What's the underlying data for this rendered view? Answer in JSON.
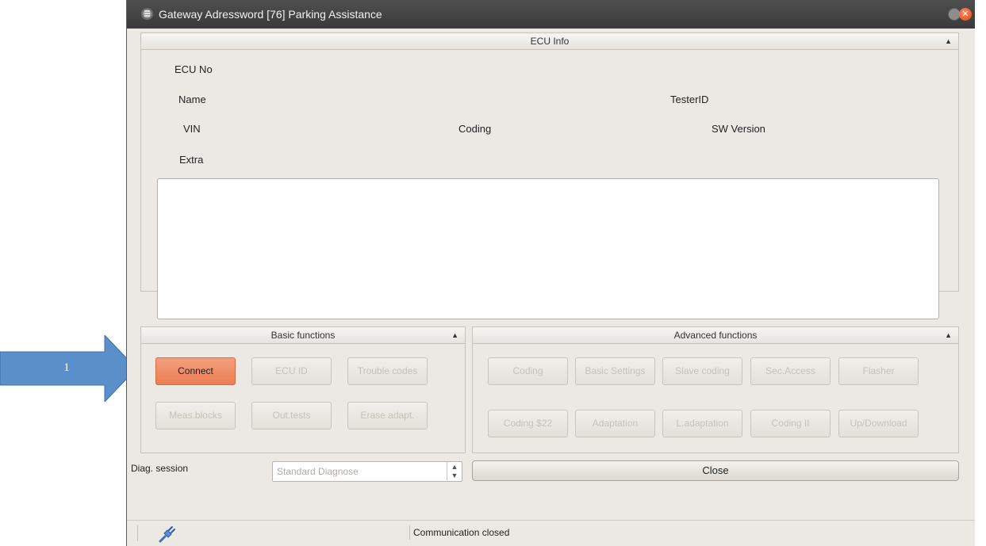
{
  "annotation": {
    "arrow_label": "1",
    "arrow_color": "#5b8fc9"
  },
  "window": {
    "title": "Gateway Adressword [76] Parking Assistance"
  },
  "ecu_info": {
    "header": "ECU Info",
    "labels": {
      "ecu_no": "ECU No",
      "name": "Name",
      "tester_id": "TesterID",
      "vin": "VIN",
      "coding": "Coding",
      "sw_version": "SW Version",
      "extra": "Extra"
    }
  },
  "basic_functions": {
    "header": "Basic functions",
    "buttons": [
      "Connect",
      "ECU ID",
      "Trouble codes",
      "Meas.blocks",
      "Out.tests",
      "Erase adapt."
    ]
  },
  "advanced_functions": {
    "header": "Advanced functions",
    "buttons": [
      "Coding",
      "Basic Settings",
      "Slave coding",
      "Sec.Access",
      "Flasher",
      "Coding $22",
      "Adaptation",
      "L.adaptation",
      "Coding II",
      "Up/Download"
    ]
  },
  "diag_session": {
    "label": "Diag. session",
    "selected": "Standard Diagnose"
  },
  "close_button": "Close",
  "status": {
    "text": "Communication closed"
  },
  "colors": {
    "primary_button": "#ec7d55",
    "disabled_text": "#c5c1ba",
    "window_bg": "#ece9e4"
  }
}
